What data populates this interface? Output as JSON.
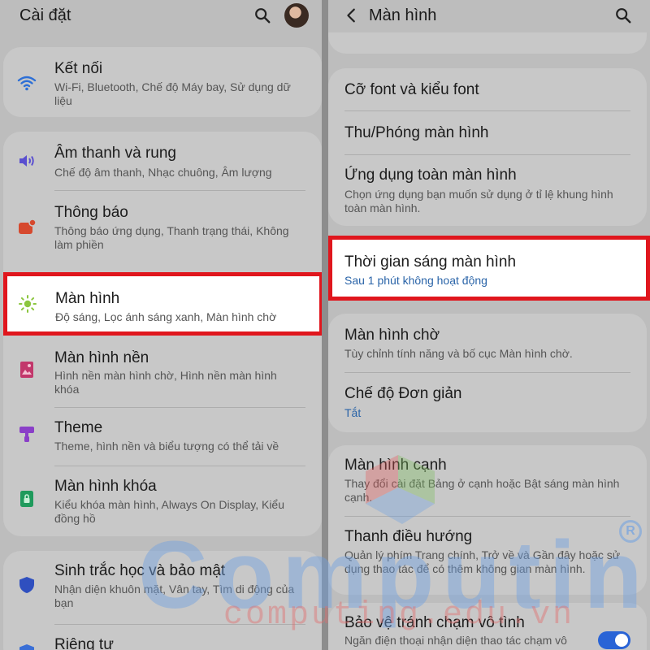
{
  "left": {
    "title": "Cài đặt",
    "items": [
      {
        "title": "Kết nối",
        "subtitle": "Wi-Fi, Bluetooth, Chế độ Máy bay, Sử dụng dữ liệu",
        "icon": "wifi-icon"
      },
      {
        "title": "Âm thanh và rung",
        "subtitle": "Chế độ âm thanh, Nhạc chuông, Âm lượng",
        "icon": "speaker-icon"
      },
      {
        "title": "Thông báo",
        "subtitle": "Thông báo ứng dụng, Thanh trạng thái, Không làm phiền",
        "icon": "notification-icon"
      },
      {
        "title": "Màn hình",
        "subtitle": "Độ sáng, Lọc ánh sáng xanh, Màn hình chờ",
        "icon": "brightness-icon"
      },
      {
        "title": "Màn hình nền",
        "subtitle": "Hình nền màn hình chờ, Hình nền màn hình khóa",
        "icon": "wallpaper-icon"
      },
      {
        "title": "Theme",
        "subtitle": "Theme, hình nền và biểu tượng có thể tải về",
        "icon": "theme-brush-icon"
      },
      {
        "title": "Màn hình khóa",
        "subtitle": "Kiểu khóa màn hình, Always On Display, Kiểu đồng hồ",
        "icon": "lock-screen-icon"
      },
      {
        "title": "Sinh trắc học và bảo mật",
        "subtitle": "Nhận diện khuôn mặt, Vân tay, Tìm di động của bạn",
        "icon": "shield-icon"
      },
      {
        "title": "Riêng tư",
        "subtitle": "",
        "icon": "privacy-icon"
      }
    ]
  },
  "right": {
    "title": "Màn hình",
    "items": [
      {
        "title": "Cỡ font và kiểu font",
        "subtitle": ""
      },
      {
        "title": "Thu/Phóng màn hình",
        "subtitle": ""
      },
      {
        "title": "Ứng dụng toàn màn hình",
        "subtitle": "Chọn ứng dụng bạn muốn sử dụng ở tỉ lệ khung hình toàn màn hình."
      },
      {
        "title": "Thời gian sáng màn hình",
        "subtitle": "Sau 1 phút không hoạt động"
      },
      {
        "title": "Màn hình chờ",
        "subtitle": "Tùy chỉnh tính năng và bố cục Màn hình chờ."
      },
      {
        "title": "Chế độ Đơn giản",
        "subtitle": "Tắt"
      },
      {
        "title": "Màn hình cạnh",
        "subtitle": "Thay đổi cài đặt Bảng ở cạnh hoặc Bật sáng màn hình cạnh."
      },
      {
        "title": "Thanh điều hướng",
        "subtitle": "Quản lý phím Trang chính, Trở về và Gần đây hoặc sử dụng thao tác để có thêm không gian màn hình."
      },
      {
        "title": "Bảo vệ tránh chạm vô tình",
        "subtitle": "Ngăn điện thoại nhận diện thao tác chạm vô"
      }
    ]
  },
  "watermark": {
    "text": "Computing",
    "sub": "computing.edu.vn",
    "reg": "R"
  },
  "colors": {
    "highlight_border": "#e0161d",
    "link_blue": "#2a64a8",
    "toggle_on": "#2a64d6"
  }
}
